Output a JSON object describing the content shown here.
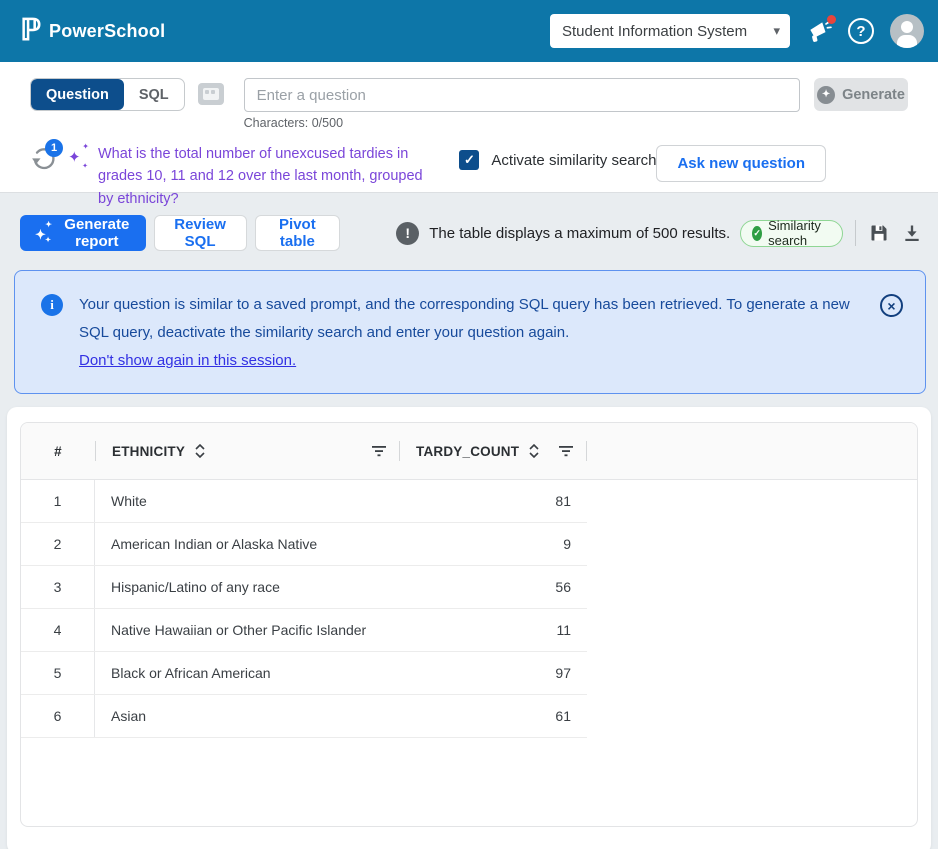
{
  "colors": {
    "topbar_blue": "#0d76a8",
    "navy": "#0d4e8c",
    "action_blue": "#1a6ff0",
    "question_purple": "#7a45d9",
    "banner_bg": "#dce8fb",
    "banner_border": "#5e92ef",
    "banner_text": "#174a9b",
    "link_indigo": "#3230e3",
    "pill_green": "#2f9e44",
    "page_bg": "#e9edf0"
  },
  "glyphs": {
    "logo": "ℙ",
    "caret": "▾",
    "sparkle_main": "✦",
    "sparkle_small_a": "✦",
    "sparkle_small_b": "✦",
    "check": "✓",
    "close": "×",
    "help": "?",
    "exclaim": "!",
    "info": "i"
  },
  "topbar": {
    "brand": "PowerSchool",
    "product_selector": "Student Information System",
    "icons": {
      "announcements": "megaphone-with-notification-dot",
      "help": "question-mark-bubble",
      "account": "person-avatar"
    }
  },
  "ask": {
    "tabs": {
      "question": "Question",
      "sql": "SQL"
    },
    "input_placeholder": "Enter a question",
    "char_counter": "Characters: 0/500",
    "generate_label": "Generate",
    "history_badge": "1",
    "question_text": "What is the total number of unexcused tardies in grades 10, 11 and 12 over the last month, grouped by ethnicity?",
    "similarity_checkbox_label": "Activate similarity search",
    "ask_new_label": "Ask new question"
  },
  "actions": {
    "generate_report": "Generate report",
    "review_sql": "Review SQL",
    "pivot_table": "Pivot table",
    "max_results_note": "The table displays a maximum of 500 results.",
    "similarity_pill": "Similarity search"
  },
  "banner": {
    "message": "Your question is similar to a saved prompt, and the corresponding SQL query has been retrieved. To generate a new SQL query, deactivate the similarity search and enter your question again.",
    "link": "Don't show again in this session."
  },
  "table": {
    "columns": {
      "num": "#",
      "ethnicity": "ETHNICITY",
      "count": "TARDY_COUNT"
    },
    "rows": [
      {
        "num": "1",
        "ethnicity": "White",
        "count": "81"
      },
      {
        "num": "2",
        "ethnicity": "American Indian or Alaska Native",
        "count": "9"
      },
      {
        "num": "3",
        "ethnicity": "Hispanic/Latino of any race",
        "count": "56"
      },
      {
        "num": "4",
        "ethnicity": "Native Hawaiian or Other Pacific Islander",
        "count": "11"
      },
      {
        "num": "5",
        "ethnicity": "Black or African American",
        "count": "97"
      },
      {
        "num": "6",
        "ethnicity": "Asian",
        "count": "61"
      }
    ]
  }
}
